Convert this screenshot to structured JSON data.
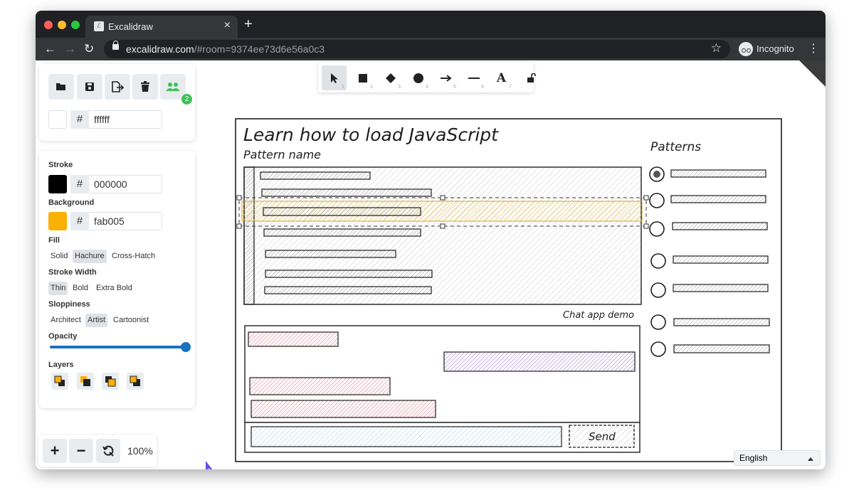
{
  "browser": {
    "tab_title": "Excalidraw",
    "tab_close": "×",
    "new_tab": "+",
    "url_host": "excalidraw.com",
    "url_path": "/#room=9374ee73d6e56a0c3",
    "profile_label": "Incognito",
    "back": "←",
    "forward": "→",
    "reload": "↻",
    "star": "☆",
    "menu": "⋮",
    "favicon_letter": "ℰ"
  },
  "colors": {
    "stroke": "#000000",
    "background_accent": "#fab005",
    "collab_badge": "#40c057"
  },
  "sidebar": {
    "top_actions": [
      {
        "name": "open",
        "icon": "folder-open-icon"
      },
      {
        "name": "save",
        "icon": "save-icon"
      },
      {
        "name": "export",
        "icon": "export-icon"
      },
      {
        "name": "clear",
        "icon": "trash-icon"
      },
      {
        "name": "collaborate",
        "icon": "users-icon"
      }
    ],
    "collaborator_count": "2",
    "canvas_bg_hash": "#",
    "canvas_bg_hex": "ffffff",
    "stroke_label": "Stroke",
    "stroke_hash": "#",
    "stroke_hex": "000000",
    "background_label": "Background",
    "background_hash": "#",
    "background_hex": "fab005",
    "fill_label": "Fill",
    "fill_options": [
      "Solid",
      "Hachure",
      "Cross-Hatch"
    ],
    "fill_selected": "Hachure",
    "stroke_width_label": "Stroke Width",
    "stroke_width_options": [
      "Thin",
      "Bold",
      "Extra Bold"
    ],
    "stroke_width_selected": "Thin",
    "sloppiness_label": "Sloppiness",
    "sloppiness_options": [
      "Architect",
      "Artist",
      "Cartoonist"
    ],
    "sloppiness_selected": "Artist",
    "opacity_label": "Opacity",
    "opacity_value": 1.0,
    "layers_label": "Layers"
  },
  "toolbar": {
    "tools": [
      {
        "name": "selection",
        "icon": "cursor-icon",
        "key": "1"
      },
      {
        "name": "rectangle",
        "icon": "square-icon",
        "key": "2"
      },
      {
        "name": "diamond",
        "icon": "diamond-icon",
        "key": "3"
      },
      {
        "name": "ellipse",
        "icon": "circle-icon",
        "key": "4"
      },
      {
        "name": "arrow",
        "icon": "arrow-icon",
        "key": "5"
      },
      {
        "name": "line",
        "icon": "line-icon",
        "key": "6"
      },
      {
        "name": "text",
        "icon": "text-icon",
        "key": "7",
        "glyph": "A"
      }
    ],
    "active_tool": "selection",
    "lock_icon": "unlock-icon"
  },
  "canvas": {
    "title": "Learn how to load JavaScript",
    "pattern_name_label": "Pattern name",
    "patterns_label": "Patterns",
    "chat_caption": "Chat app demo",
    "send_label": "Send"
  },
  "zoom": {
    "in_label": "+",
    "out_label": "−",
    "reset_icon": "zoom-reset-icon",
    "level": "100%"
  },
  "language": {
    "selected": "English"
  }
}
